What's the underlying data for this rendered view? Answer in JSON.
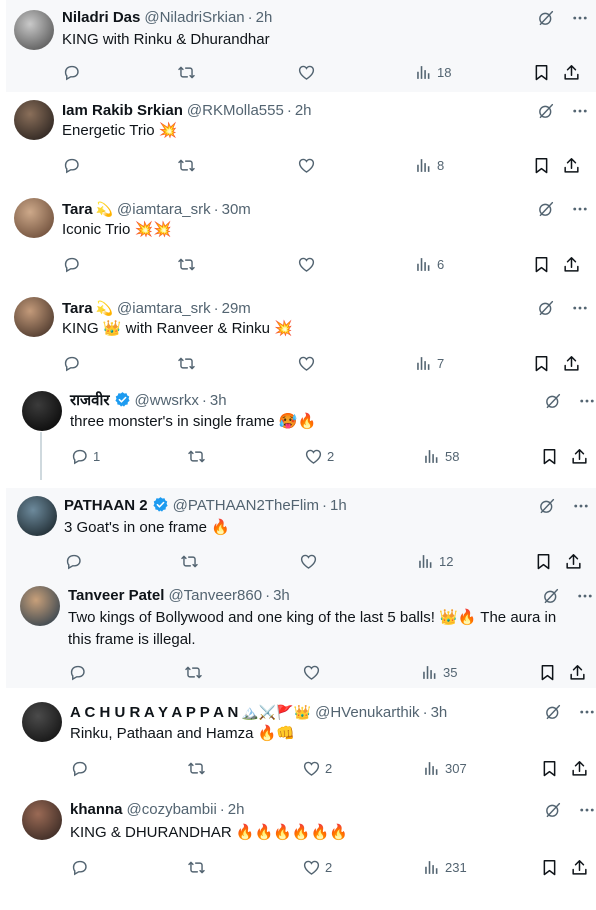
{
  "tweets": [
    {
      "name": "Niladri Das",
      "badge": "",
      "handle": "@NiladriSrkian",
      "time": "2h",
      "text": "KING with Rinku & Dhurandhar",
      "replies": "",
      "retweets": "",
      "likes": "",
      "views": "18"
    },
    {
      "name": "Iam Rakib Srkian",
      "badge": "",
      "handle": "@RKMolla555",
      "time": "2h",
      "text": "Energetic Trio 💥",
      "replies": "",
      "retweets": "",
      "likes": "",
      "views": "8"
    },
    {
      "name": "Tara",
      "badge": "💫",
      "handle": "@iamtara_srk",
      "time": "30m",
      "text": "Iconic Trio 💥💥",
      "replies": "",
      "retweets": "",
      "likes": "",
      "views": "6"
    },
    {
      "name": "Tara",
      "badge": "💫",
      "handle": "@iamtara_srk",
      "time": "29m",
      "text": "KING 👑 with Ranveer & Rinku 💥",
      "replies": "",
      "retweets": "",
      "likes": "",
      "views": "7"
    },
    {
      "name": "राजवीर",
      "badge": "",
      "handle": "@wwsrkx",
      "time": "3h",
      "text": "three monster's in single frame 🥵🔥",
      "replies": "1",
      "retweets": "",
      "likes": "2",
      "views": "58"
    },
    {
      "name": "PATHAAN 2",
      "badge": "",
      "handle": "@PATHAAN2TheFlim",
      "time": "1h",
      "text": "3 Goat's in one frame 🔥",
      "replies": "",
      "retweets": "",
      "likes": "",
      "views": "12"
    },
    {
      "name": "Tanveer Patel",
      "badge": "",
      "handle": "@Tanveer860",
      "time": "3h",
      "text": "Two kings of Bollywood and one king of the last 5 balls! 👑🔥 The aura in this frame is illegal.",
      "replies": "",
      "retweets": "",
      "likes": "",
      "views": "35"
    },
    {
      "name": "A C H U  R A Y A P P A N",
      "badge": "🏔️⚔️🚩👑",
      "handle": "@HVenukarthik",
      "time": "3h",
      "text": "Rinku, Pathaan and Hamza 🔥👊",
      "replies": "",
      "retweets": "",
      "likes": "2",
      "views": "307"
    },
    {
      "name": "khanna",
      "badge": "",
      "handle": "@cozybambii",
      "time": "2h",
      "text": "KING & DHURANDHAR 🔥🔥🔥🔥🔥🔥",
      "replies": "",
      "retweets": "",
      "likes": "2",
      "views": "231"
    }
  ],
  "icons": {
    "reply": "reply-icon",
    "retweet": "retweet-icon",
    "like": "heart-icon",
    "views": "views-icon",
    "bookmark": "bookmark-icon",
    "share": "share-icon",
    "grok": "grok-icon",
    "more": "more-icon",
    "verified": "verified-badge-icon"
  },
  "colors": {
    "text": "#0f1419",
    "secondary": "#536471",
    "verified": "#1d9bf0",
    "highlight_bg": "#f7f8fa"
  }
}
